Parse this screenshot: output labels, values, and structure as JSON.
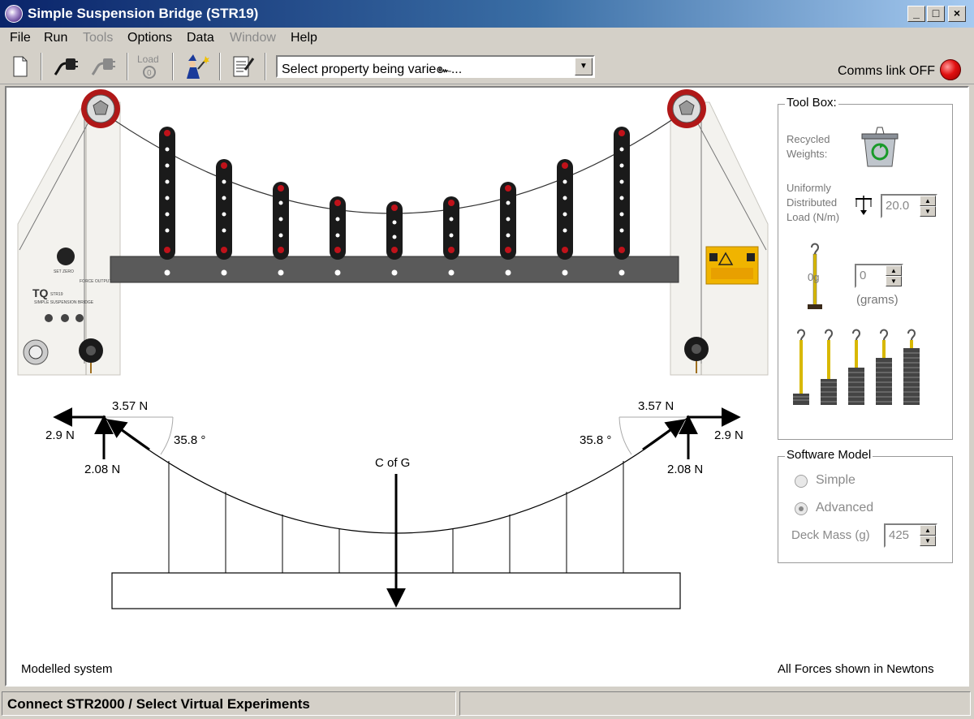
{
  "window": {
    "title": "Simple Suspension Bridge (STR19)",
    "min": "_",
    "max": "□",
    "close": "×"
  },
  "menu": {
    "file": "File",
    "run": "Run",
    "tools": "Tools",
    "options": "Options",
    "data": "Data",
    "window": "Window",
    "help": "Help"
  },
  "toolbar": {
    "load_label": "Load",
    "property_combo": "Select property being varie๛...",
    "comms_label": "Comms link OFF"
  },
  "toolbox": {
    "title": "Tool Box:",
    "recycled": "Recycled Weights:",
    "udl_label": "Uniformly Distributed Load (N/m)",
    "udl_value": "20.0",
    "hanger_label": "0g",
    "hanger_value": "0",
    "grams": "(grams)"
  },
  "software_model": {
    "title": "Software Model",
    "simple": "Simple",
    "advanced": "Advanced",
    "selected": "Advanced",
    "deck_mass_label": "Deck Mass (g)",
    "deck_mass_value": "425"
  },
  "diagram": {
    "left_tension": "3.57 N",
    "left_horizontal": "2.9 N",
    "left_vertical": "2.08 N",
    "left_angle": "35.8 °",
    "right_tension": "3.57 N",
    "right_horizontal": "2.9 N",
    "right_vertical": "2.08 N",
    "right_angle": "35.8 °",
    "cog_label": "C of G",
    "modelled_label": "Modelled system",
    "forces_note": "All Forces shown in Newtons"
  },
  "apparatus": {
    "label_set_zero": "SET ZERO",
    "label_force_output": "FORCE OUTPUT",
    "label_model": "STR19",
    "label_name": "SIMPLE SUSPENSION BRIDGE"
  },
  "status": {
    "left": "Connect STR2000 / Select Virtual Experiments",
    "right": ""
  },
  "colors": {
    "accent_red": "#c0121a",
    "rod": "#1a1a1a",
    "deck": "#5a5a5a",
    "warning": "#f0b400"
  }
}
